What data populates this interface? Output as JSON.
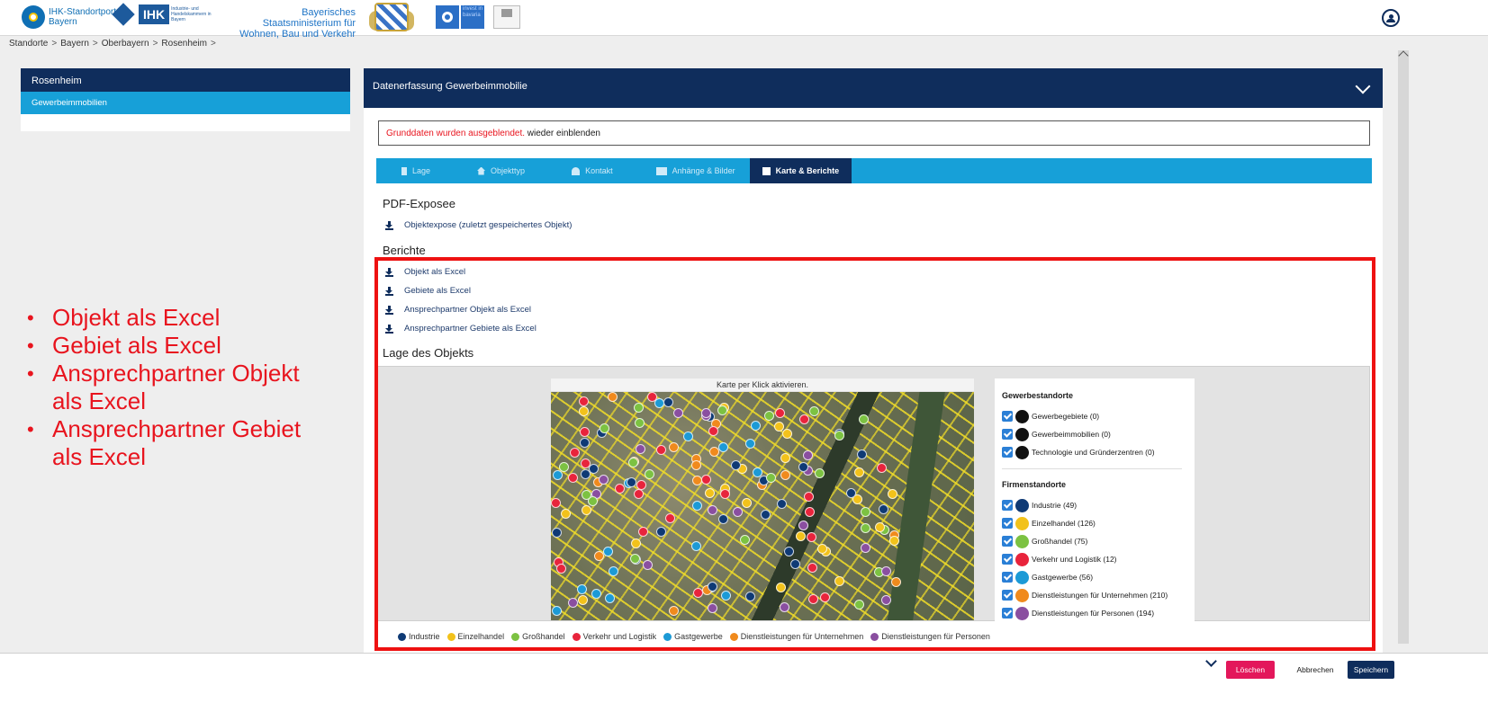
{
  "header": {
    "portal_line1": "IHK-Standortportal",
    "portal_line2": "Bayern",
    "ihk_label": "IHK",
    "ihk_subtext": "Industrie- und Handelskammern in Bayern",
    "ministry_line1": "Bayerisches Staatsministerium für",
    "ministry_line2": "Wohnen, Bau und Verkehr",
    "invest_text": "invest in bavaria"
  },
  "breadcrumb": [
    "Standorte",
    "Bayern",
    "Oberbayern",
    "Rosenheim"
  ],
  "breadcrumb_sep": ">",
  "left_panel": {
    "title": "Rosenheim",
    "selected_item": "Gewerbeimmobilien"
  },
  "annotation_bullets": [
    "Objekt als Excel",
    "Gebiet als Excel",
    "Ansprechpartner Objekt als Excel",
    "Ansprechpartner Gebiet als Excel"
  ],
  "main": {
    "title": "Datenerfassung Gewerbeimmobilie",
    "notice_red": "Grunddaten wurden ausgeblendet.",
    "notice_link": "wieder einblenden",
    "tabs": [
      {
        "label": "Lage",
        "icon": "pin-icon"
      },
      {
        "label": "Objekttyp",
        "icon": "home-icon"
      },
      {
        "label": "Kontakt",
        "icon": "person-icon"
      },
      {
        "label": "Anhänge & Bilder",
        "icon": "images-icon"
      },
      {
        "label": "Karte & Berichte",
        "icon": "clipboard-icon",
        "active": true
      }
    ],
    "pdf_section_title": "PDF-Exposee",
    "pdf_link": "Objektexpose (zuletzt gespeichertes Objekt)",
    "reports_section_title": "Berichte",
    "report_links": [
      "Objekt als Excel",
      "Gebiete als Excel",
      "Ansprechpartner Objekt als Excel",
      "Ansprechpartner Gebiete als Excel"
    ],
    "map_section_title": "Lage des Objekts",
    "map_caption": "Karte per Klick aktivieren."
  },
  "map_legend": {
    "group1_title": "Gewerbestandorte",
    "group1_items": [
      {
        "label": "Gewerbegebiete (0)",
        "color": "#111111"
      },
      {
        "label": "Gewerbeimmobilien (0)",
        "color": "#111111"
      },
      {
        "label": "Technologie und Gründerzentren (0)",
        "color": "#111111"
      }
    ],
    "group2_title": "Firmenstandorte",
    "group2_items": [
      {
        "label": "Industrie (49)",
        "color": "#0f3a75"
      },
      {
        "label": "Einzelhandel (126)",
        "color": "#f2c21b"
      },
      {
        "label": "Großhandel (75)",
        "color": "#7cc242"
      },
      {
        "label": "Verkehr und Logistik (12)",
        "color": "#e8243c"
      },
      {
        "label": "Gastgewerbe (56)",
        "color": "#1c9ad6"
      },
      {
        "label": "Dienstleistungen für Unternehmen (210)",
        "color": "#f08a1d"
      },
      {
        "label": "Dienstleistungen für Personen (194)",
        "color": "#8a4fa0"
      }
    ]
  },
  "bottom_legend": [
    {
      "label": "Industrie",
      "color": "#0f3a75"
    },
    {
      "label": "Einzelhandel",
      "color": "#f2c21b"
    },
    {
      "label": "Großhandel",
      "color": "#7cc242"
    },
    {
      "label": "Verkehr und Logistik",
      "color": "#e8243c"
    },
    {
      "label": "Gastgewerbe",
      "color": "#1c9ad6"
    },
    {
      "label": "Dienstleistungen für Unternehmen",
      "color": "#f08a1d"
    },
    {
      "label": "Dienstleistungen für Personen",
      "color": "#8a4fa0"
    }
  ],
  "actions": {
    "delete": "Löschen",
    "cancel": "Abbrechen",
    "save": "Speichern"
  }
}
